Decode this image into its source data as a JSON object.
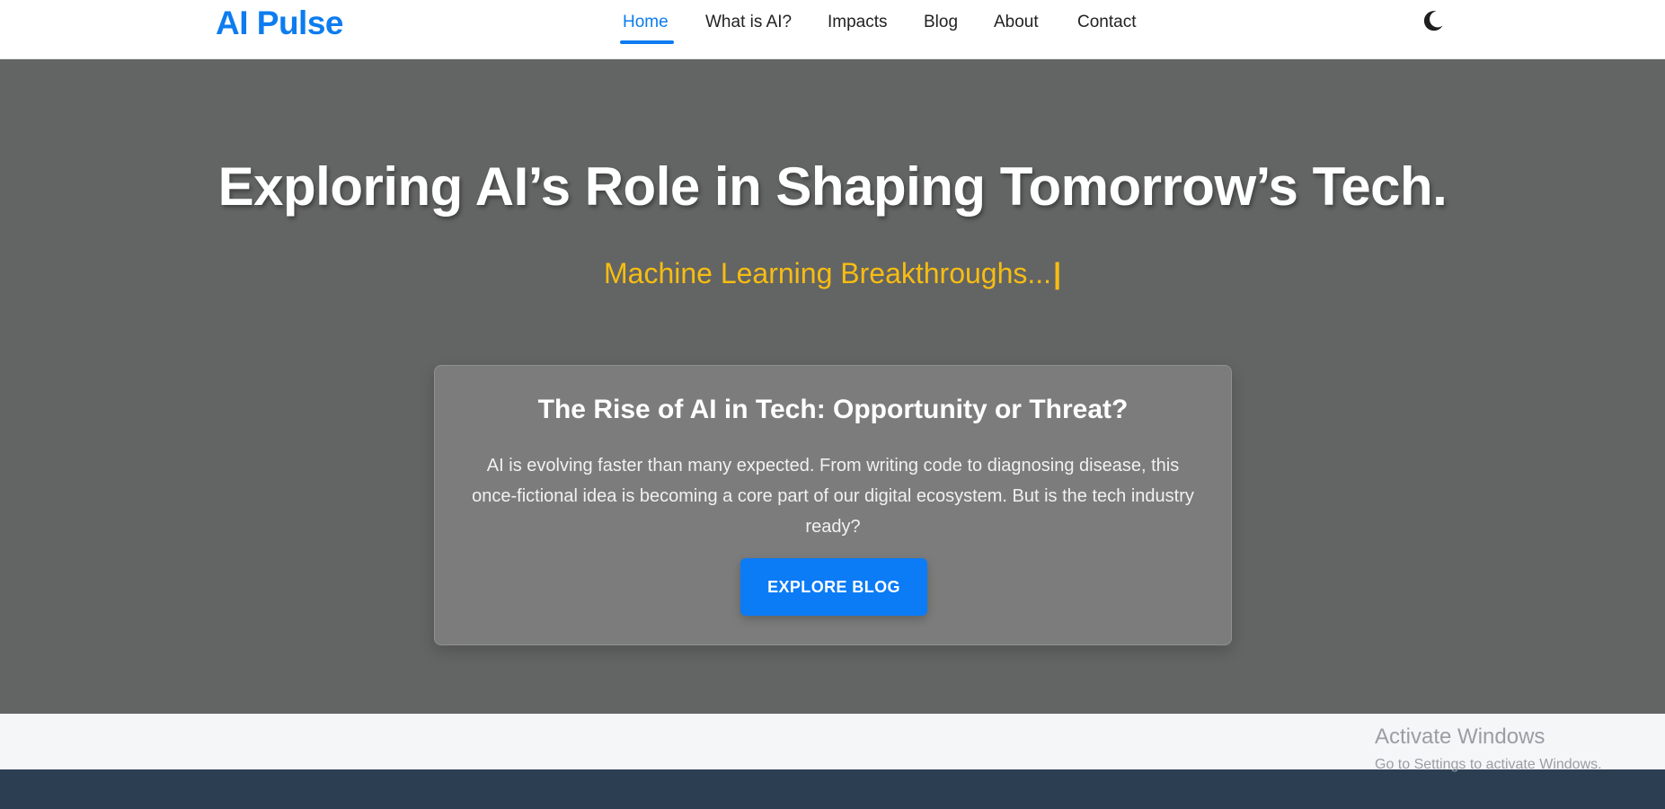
{
  "brand": {
    "name": "AI Pulse",
    "color": "#0d7cf0"
  },
  "nav": {
    "items": [
      {
        "label": "Home",
        "active": true
      },
      {
        "label": "What is AI?"
      },
      {
        "label": "Impacts"
      },
      {
        "label": "Blog"
      },
      {
        "label": "About"
      },
      {
        "label": "Contact"
      }
    ],
    "theme_toggle_icon": "moon-icon"
  },
  "hero": {
    "title": "Exploring AI’s Role in Shaping Tomorrow’s Tech.",
    "typing_text": "Machine Learning Breakthroughs...",
    "caret": "|",
    "typing_color": "#f6bd12",
    "background": "#636464"
  },
  "card": {
    "title": "The Rise of AI in Tech: Opportunity or Threat?",
    "text": "AI is evolving faster than many expected. From writing code to diagnosing disease, this once-fictional idea is becoming a core part of our digital ecosystem. But is the tech industry ready?",
    "button_label": "EXPLORE BLOG",
    "button_color": "#0b7bf6"
  },
  "footer": {
    "background": "#2c3e52"
  },
  "watermark": {
    "title": "Activate Windows",
    "subtitle": "Go to Settings to activate Windows."
  }
}
